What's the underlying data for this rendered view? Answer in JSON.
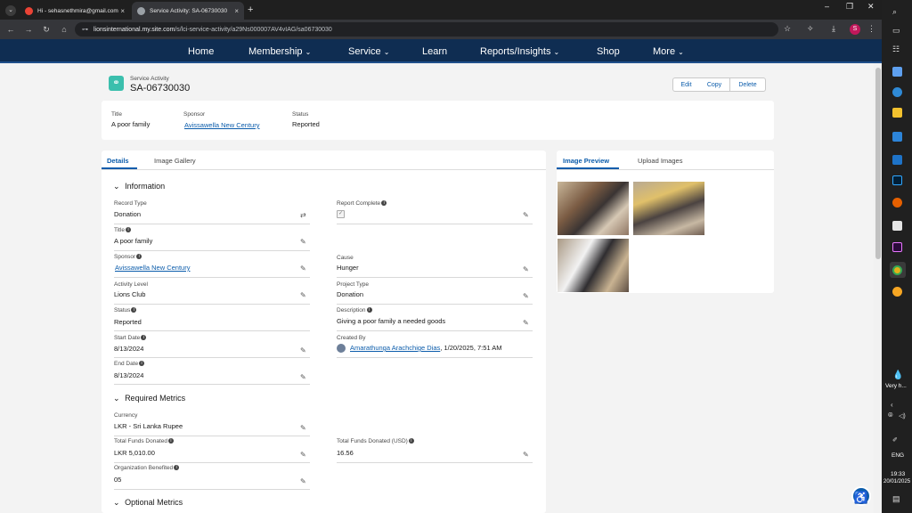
{
  "browser": {
    "tabs": [
      {
        "title": "Hi - sehasnethmira@gmail.com"
      },
      {
        "title": "Service Activity: SA-06730030"
      }
    ],
    "url_host": "lionsinternational.my.site.com",
    "url_path": "/s/lci-service-activity/a29Ns000007AV4vIAG/sa06730030",
    "profile_initial": "S"
  },
  "nav": {
    "items": [
      "Home",
      "Membership",
      "Service",
      "Learn",
      "Reports/Insights",
      "Shop",
      "More"
    ]
  },
  "record": {
    "object_label": "Service Activity",
    "name": "SA-06730030",
    "buttons": {
      "edit": "Edit",
      "copy": "Copy",
      "delete": "Delete"
    },
    "highlights": {
      "title_label": "Title",
      "title_value": "A poor family",
      "sponsor_label": "Sponsor",
      "sponsor_value": "Avissawella New Century",
      "status_label": "Status",
      "status_value": "Reported"
    }
  },
  "tabs": {
    "details": "Details",
    "gallery": "Image Gallery"
  },
  "information": {
    "heading": "Information",
    "record_type_label": "Record Type",
    "record_type_value": "Donation",
    "report_complete_label": "Report Complete",
    "title_label": "Title",
    "title_value": "A poor family",
    "sponsor_label": "Sponsor",
    "sponsor_value": "Avissawella New Century",
    "cause_label": "Cause",
    "cause_value": "Hunger",
    "activity_level_label": "Activity Level",
    "activity_level_value": "Lions Club",
    "project_type_label": "Project Type",
    "project_type_value": "Donation",
    "status_label": "Status",
    "status_value": "Reported",
    "description_label": "Description",
    "description_value": "Giving a poor family a needed goods",
    "start_date_label": "Start Date",
    "start_date_value": "8/13/2024",
    "created_by_label": "Created By",
    "created_by_name": "Amarathunga Arachchige Dias",
    "created_by_date": ", 1/20/2025, 7:51 AM",
    "end_date_label": "End Date",
    "end_date_value": "8/13/2024"
  },
  "required_metrics": {
    "heading": "Required Metrics",
    "currency_label": "Currency",
    "currency_value": "LKR - Sri Lanka Rupee",
    "funds_label": "Total Funds Donated",
    "funds_value": "LKR 5,010.00",
    "funds_usd_label": "Total Funds Donated (USD)",
    "funds_usd_value": "16.56",
    "org_label": "Organization Benefited",
    "org_value": "05"
  },
  "optional_metrics": {
    "heading": "Optional Metrics"
  },
  "image_panel": {
    "preview_tab": "Image Preview",
    "upload_tab": "Upload Images"
  },
  "taskbar": {
    "weather": "Very h...",
    "lang": "ENG",
    "time": "19:33",
    "date": "20/01/2025"
  }
}
